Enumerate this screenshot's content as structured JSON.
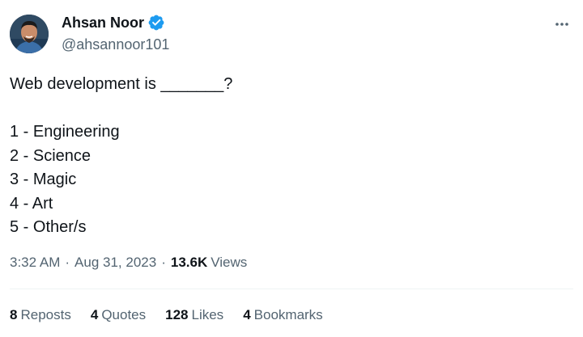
{
  "author": {
    "display_name": "Ahsan Noor",
    "handle": "@ahsannoor101",
    "verified_icon": "verified-badge-icon",
    "verified_color": "#1d9bf0"
  },
  "more_icon": "more-options-icon",
  "tweet": {
    "lines": [
      "Web development is _______?",
      "",
      "1 - Engineering",
      "2 - Science",
      "3 - Magic",
      "4 - Art",
      "5 - Other/s"
    ]
  },
  "meta": {
    "time": "3:32 AM",
    "separator": "·",
    "date": "Aug 31, 2023",
    "views_count": "13.6K",
    "views_label": "Views"
  },
  "stats": [
    {
      "count": "8",
      "label": "Reposts"
    },
    {
      "count": "4",
      "label": "Quotes"
    },
    {
      "count": "128",
      "label": "Likes"
    },
    {
      "count": "4",
      "label": "Bookmarks"
    }
  ]
}
